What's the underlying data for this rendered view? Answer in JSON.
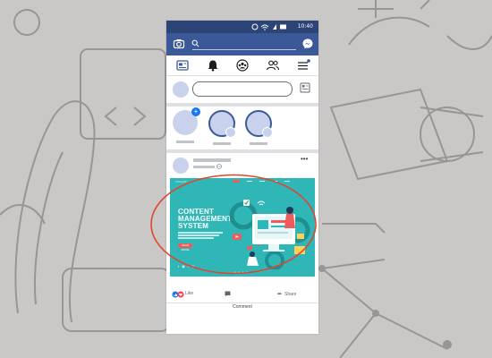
{
  "status_bar": {
    "time": "10:40"
  },
  "post_image": {
    "brand": "TOOLKIT",
    "title": "CONTENT\nMANAGEMENT\nSYSTEM",
    "button": "READ MORE",
    "social": "f ◉ t ◎",
    "pagination": "• • • •"
  },
  "reactions": {
    "like_label": "Like",
    "share_label": "Share"
  },
  "actions": {
    "comment_label": "Comment"
  },
  "colors": {
    "header": "#3b5998",
    "status_bar": "#2d4476",
    "post_image_bg": "#2fb7b7",
    "highlight": "#e0452e",
    "placeholder": "#c8d2ec"
  },
  "icons": [
    "camera-icon",
    "search-icon",
    "messenger-icon",
    "news-feed-icon",
    "bell-icon",
    "groups-icon",
    "friends-icon",
    "menu-icon",
    "photo-icon",
    "globe-icon",
    "more-icon",
    "like-icon",
    "love-icon",
    "comment-icon",
    "share-icon"
  ]
}
